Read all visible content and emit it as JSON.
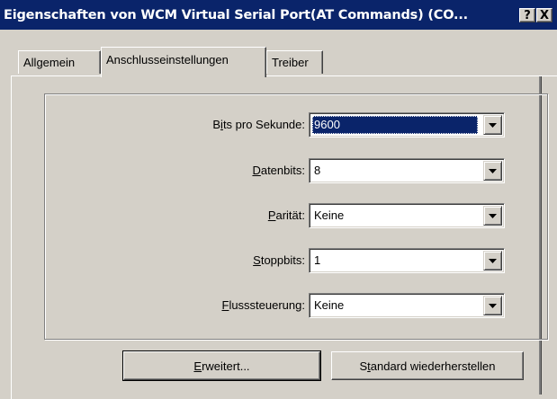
{
  "window": {
    "title": "Eigenschaften von WCM Virtual Serial Port(AT Commands) (CO...",
    "help_button": "?",
    "close_button": "X"
  },
  "tabs": [
    {
      "label": "Allgemein",
      "active": false
    },
    {
      "label": "Anschlusseinstellungen",
      "active": true
    },
    {
      "label": "Treiber",
      "active": false
    }
  ],
  "settings": {
    "bits_per_second": {
      "label_pre": "B",
      "label_key": "i",
      "label_post": "ts pro Sekunde:",
      "value": "9600"
    },
    "data_bits": {
      "label_pre": "",
      "label_key": "D",
      "label_post": "atenbits:",
      "value": "8"
    },
    "parity": {
      "label_pre": "",
      "label_key": "P",
      "label_post": "arität:",
      "value": "Keine"
    },
    "stop_bits": {
      "label_pre": "",
      "label_key": "S",
      "label_post": "toppbits:",
      "value": "1"
    },
    "flow_control": {
      "label_pre": "",
      "label_key": "F",
      "label_post": "lusssteuerung:",
      "value": "Keine"
    }
  },
  "buttons": {
    "advanced": {
      "pre": "",
      "key": "E",
      "post": "rweitert..."
    },
    "restore_defaults": {
      "pre": "S",
      "key": "t",
      "post": "andard wiederherstellen"
    }
  },
  "colors": {
    "title_bar": "#0a246a",
    "face": "#d4d0c8",
    "selection": "#0a246a"
  }
}
